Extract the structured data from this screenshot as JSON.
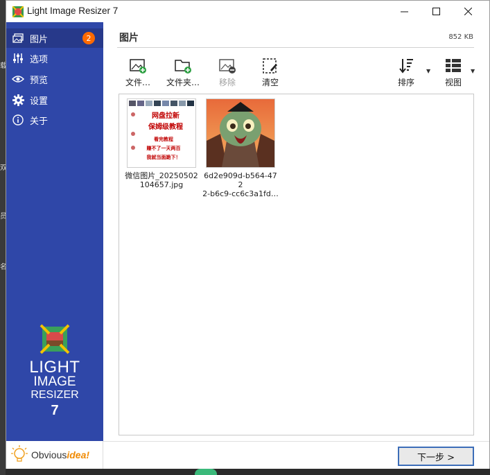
{
  "window": {
    "title": "Light Image Resizer 7",
    "controls": {
      "minimize": "minimize",
      "maximize": "maximize",
      "close": "close"
    }
  },
  "sidebar": {
    "items": [
      {
        "label": "图片",
        "icon": "images-icon",
        "badge": "2",
        "active": true
      },
      {
        "label": "选项",
        "icon": "sliders-icon"
      },
      {
        "label": "预览",
        "icon": "eye-icon"
      },
      {
        "label": "设置",
        "icon": "gear-icon"
      },
      {
        "label": "关于",
        "icon": "info-icon"
      }
    ],
    "logo": {
      "line1": "LIGHT",
      "line2": "IMAGE",
      "line3": "RESIZER",
      "version": "7"
    },
    "brand": {
      "prefix": "Obvious",
      "suffix": "idea!"
    }
  },
  "main": {
    "title": "图片",
    "size": "852 KB",
    "toolbar": {
      "add_files": "文件…",
      "add_folder": "文件夹…",
      "remove": "移除",
      "clear": "清空",
      "sort": "排序",
      "view": "视图"
    },
    "files": [
      {
        "name": "微信图片_20250502104657.jpg",
        "caption_line1": "微信图片_20250502",
        "caption_line2": "104657.jpg",
        "thumb_text": [
          "网盘拉新",
          "保姆级教程",
          "看完教程",
          "赚不了一天两百",
          "我就当面跪下！"
        ]
      },
      {
        "name": "6d2e909d-b564-4722-b6c9-cc6c3a1fd…",
        "caption_line1": "6d2e909d-b564-472",
        "caption_line2": "2-b6c9-cc6c3a1fd…"
      }
    ],
    "next_button": "下一步 >"
  },
  "desktop": {
    "left_glyphs": [
      "载",
      "双",
      "员",
      "名"
    ]
  },
  "colors": {
    "sidebar": "#2f47a8",
    "sidebar_active": "#27398a",
    "badge": "#ff6a00",
    "accent": "#3c6db8"
  }
}
